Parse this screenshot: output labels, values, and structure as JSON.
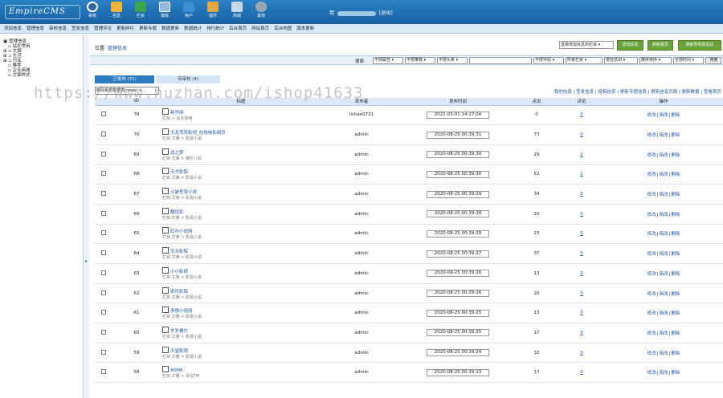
{
  "app": {
    "logo": "EmpireCMS",
    "user_suffix": "用",
    "logout": "[退出]"
  },
  "nav": [
    {
      "label": "系统",
      "color": "#2f6aa8"
    },
    {
      "label": "信息",
      "color": "#f0b33c"
    },
    {
      "label": "栏目",
      "color": "#3fa34a"
    },
    {
      "label": "模板",
      "color": "#8fb9e2"
    },
    {
      "label": "用户",
      "color": "#3b8fd6"
    },
    {
      "label": "插件",
      "color": "#e3a84a"
    },
    {
      "label": "商城",
      "color": "#c9d8e6"
    },
    {
      "label": "其他",
      "color": "#9aa7b5"
    }
  ],
  "menu": [
    "添加信息",
    "管理信息",
    "审核信息",
    "签发信息",
    "管理评论",
    "更新碎片",
    "更新专题",
    "数据更新",
    "数据统计",
    "排行统计",
    "后台首页",
    "网站首页",
    "后台地图",
    "版本更新"
  ],
  "tree": [
    "管理信息",
    "站长常用",
    "文娱",
    "生活",
    "行业",
    "推荐",
    "企业商城",
    "文章样式"
  ],
  "breadcrumb": {
    "label": "位置:",
    "link": "管理信息"
  },
  "top_select": "选择增加信息的栏目",
  "buttons": [
    "增加信息",
    "刷新首页",
    "刷新所有信息JS"
  ],
  "search": {
    "label": "搜索:",
    "keyword": "",
    "selects": [
      "不限属性",
      "不限推荐",
      "不限头条",
      "不限字段",
      "所有栏目",
      "按信息ID",
      "降序排序",
      "全部时间"
    ],
    "submit": "搜索"
  },
  "tabs": {
    "published": "已发布 (71)",
    "pending": "待审核 (4)"
  },
  "view_select": "新闻系统数据表(news)",
  "actions": [
    "我的信息",
    "签发信息",
    "投稿信息",
    "更新专题信息",
    "更新信息页面",
    "更新数据",
    "查看首页"
  ],
  "columns": [
    "",
    "ID",
    "标题",
    "发布者",
    "发布时间",
    "点击",
    "评论",
    "操作"
  ],
  "ops": [
    "修改",
    "简改",
    "删除"
  ],
  "rows": [
    {
      "id": "78",
      "title": "新华网",
      "cat": "栏目:> 站长常用",
      "author": "lichao0721",
      "time": "2021-03-01 14:27:04",
      "hits": "0",
      "cm": "0"
    },
    {
      "id": "70",
      "title": "天龙弯弯影视_在线电影网页",
      "cat": "栏目:文娱 > 影视小说",
      "author": "admin",
      "time": "2020-08-25 00:39:31",
      "hits": "77",
      "cm": "0"
    },
    {
      "id": "69",
      "title": "龙之梦",
      "cat": "栏目:文娱 > 娱乐八卦",
      "author": "admin",
      "time": "2020-08-25 00:39:30",
      "hits": "29",
      "cm": "0"
    },
    {
      "id": "68",
      "title": "天才影院",
      "cat": "栏目:文娱 > 影视小说",
      "author": "admin",
      "time": "2020-08-25 00:39:30",
      "hits": "52",
      "cm": "1"
    },
    {
      "id": "67",
      "title": "斗破苍穹小说",
      "cat": "栏目:文娱 > 影视小说",
      "author": "admin",
      "time": "2020-08-25 00:39:29",
      "hits": "34",
      "cm": "0"
    },
    {
      "id": "66",
      "title": "酷优影",
      "cat": "栏目:文娱 > 影视小说",
      "author": "admin",
      "time": "2020-08-25 00:39:28",
      "hits": "20",
      "cm": "0"
    },
    {
      "id": "65",
      "title": "红叶小说网",
      "cat": "栏目:文娱 > 影视小说",
      "author": "admin",
      "time": "2020-08-25 00:39:28",
      "hits": "23",
      "cm": "0"
    },
    {
      "id": "64",
      "title": "天天影院",
      "cat": "栏目:文娱 > 影视小说",
      "author": "admin",
      "time": "2020-08-25 00:39:27",
      "hits": "37",
      "cm": "0"
    },
    {
      "id": "63",
      "title": "小小影视",
      "cat": "栏目:文娱 > 影视小说",
      "author": "admin",
      "time": "2020-08-25 00:39:26",
      "hits": "13",
      "cm": "0"
    },
    {
      "id": "62",
      "title": "奇乐影院",
      "cat": "栏目:文娱 > 影视小说",
      "author": "admin",
      "time": "2020-08-25 00:39:26",
      "hits": "20",
      "cm": "0"
    },
    {
      "id": "61",
      "title": "多情小说网",
      "cat": "栏目:文娱 > 影视小说",
      "author": "admin",
      "time": "2020-08-25 00:39:25",
      "hits": "13",
      "cm": "0"
    },
    {
      "id": "60",
      "title": "岁岁看片",
      "cat": "栏目:文娱 > 影视小说",
      "author": "admin",
      "time": "2020-08-25 00:39:25",
      "hits": "17",
      "cm": "0"
    },
    {
      "id": "59",
      "title": "天堂影视",
      "cat": "栏目:文娱 > 影视小说",
      "author": "admin",
      "time": "2020-08-25 00:39:24",
      "hits": "32",
      "cm": "0"
    },
    {
      "id": "58",
      "title": "ASMR",
      "cat": "栏目:文娱 > 百位FM",
      "author": "admin",
      "time": "2020-08-25 00:39:23",
      "hits": "17",
      "cm": "0"
    }
  ],
  "watermark": "https://www.huzhan.com/ishop41633"
}
